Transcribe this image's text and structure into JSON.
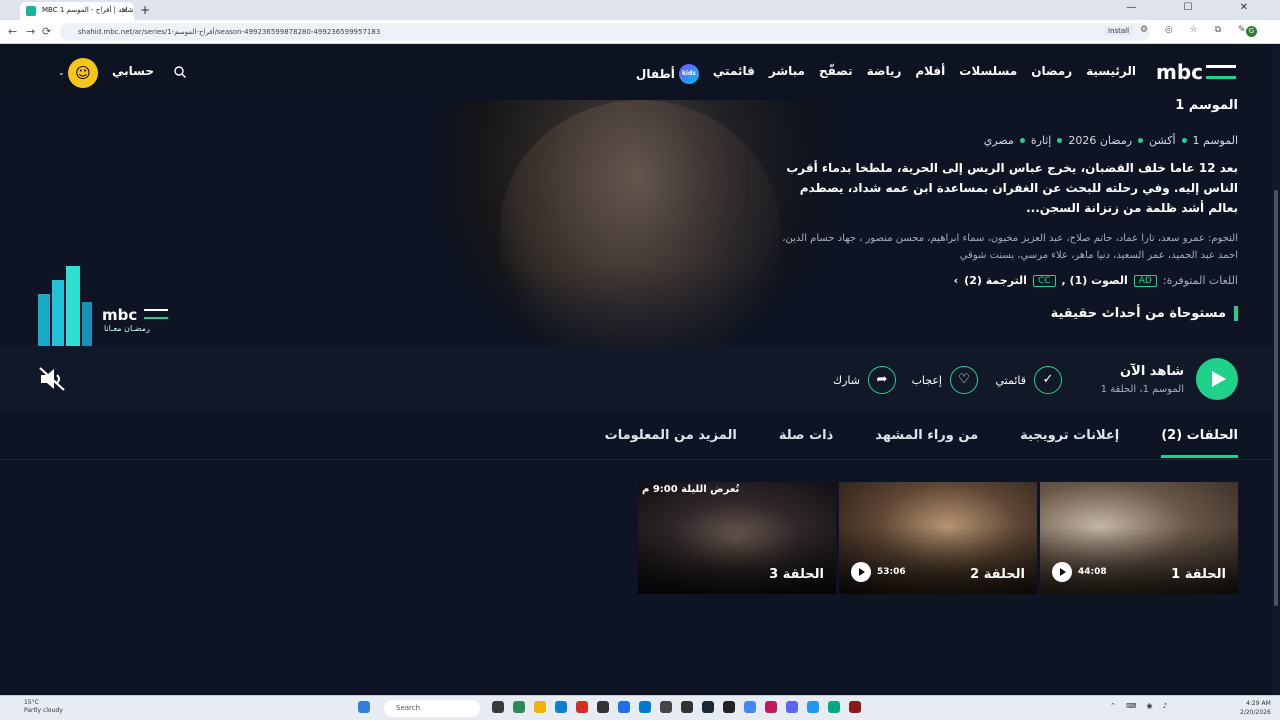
{
  "browser": {
    "tab_title": "MBC شاهد | أفراح - الموسم 1",
    "tab_close": "✕",
    "new_tab": "+",
    "url": "shahid.mbc.net/ar/series/أفراح-الموسم-1/season-499236599878280-499236599957183",
    "install_label": "Install",
    "profile_initial": "G",
    "controls": "— ☐ ✕",
    "nav": {
      "back": "←",
      "forward": "→",
      "reload": "⟳"
    },
    "toolbar_icons": "⚙ ◎ ☆ ⧉ ✎"
  },
  "nav": {
    "menu": [
      "الرئيسية",
      "رمضان",
      "مسلسلات",
      "أفلام",
      "رياضة",
      "تصفّح",
      "مباشر",
      "قائمتي"
    ],
    "kids_label": "أطفال",
    "kids_badge": "kids",
    "account_label": "حسابي",
    "avatar_glyph": "☺",
    "chevron": "⌄"
  },
  "hero": {
    "season_title": "الموسم 1",
    "meta": [
      "الموسم 1",
      "أكشن",
      "رمضان 2026",
      "إثارة",
      "مصري"
    ],
    "description": "بعد 12 عاما خلف القضبان، يخرج عباس الريس إلى الحرية، ملطخا بدماء أقرب الناس إليه. وفي رحلته للبحث عن الغفران بمساعدة ابن عمه شداد، يصطدم بعالم أشد ظلمة من زنزانة السجن...",
    "cast": "النجوم: عمرو سعد، تارا عماد، حاتم صلاح، عبد العزيز مخيون، سماء ابراهيم، محسن منصور ، جهاد حسام الدين، احمد عبد الحميد، عمر السعيد، دنيا ماهر، علاء مرسي، بسنت شوقي",
    "languages_label": "اللغات المتوفرة:",
    "ad_badge": "AD",
    "audio_label": "الصوت (1) ,",
    "cc_badge": "CC",
    "subtitles_label": "الترجمة (2)",
    "languages_more": "›",
    "tagline": "مستوحاة من أحداث حقيقية",
    "ramadan_sub": "رمضـان معـانا"
  },
  "actions": {
    "watch_title": "شاهد الآن",
    "watch_sub": "الموسم 1، الحلقة 1",
    "mylist_label": "قائمتي",
    "like_label": "إعجاب",
    "share_label": "شارك",
    "mylist_icon": "✓",
    "like_icon": "♡",
    "share_icon": "➦"
  },
  "tabs": [
    "الحلقات (2)",
    "إعلانات ترويجية",
    "من وراء المشهد",
    "ذات صلة",
    "المزيد من المعلومات"
  ],
  "episodes": [
    {
      "label": "الحلقة 1",
      "duration": "44:08",
      "tonight": ""
    },
    {
      "label": "الحلقة 2",
      "duration": "53:06",
      "tonight": ""
    },
    {
      "label": "الحلقة 3",
      "duration": "",
      "tonight": "تُعرض الليلة 9:00 م"
    }
  ],
  "taskbar": {
    "temp": "15°C",
    "weather": "Partly cloudy",
    "search": "Search",
    "tray_icons": "⌃ ⌨ ◉ ♪",
    "time": "4:29 AM",
    "date": "2/20/2026"
  },
  "colors": {
    "accent": "#1fd18b",
    "background": "#0e1424"
  }
}
